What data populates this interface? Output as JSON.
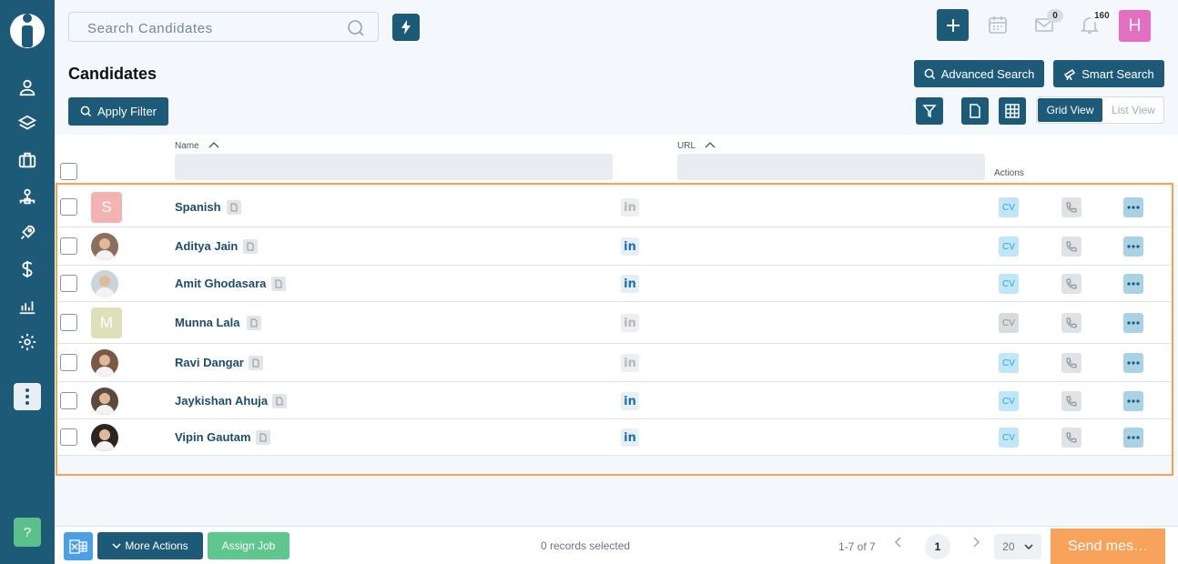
{
  "search": {
    "placeholder": "Search Candidates"
  },
  "header": {
    "mail_badge": "0",
    "notif_badge": "160",
    "user_initial": "H"
  },
  "page": {
    "title": "Candidates"
  },
  "buttons": {
    "advanced_search": "Advanced Search",
    "smart_search": "Smart Search",
    "apply_filter": "Apply Filter",
    "grid_view": "Grid View",
    "list_view": "List View"
  },
  "table": {
    "columns": {
      "name": "Name",
      "url": "URL",
      "actions": "Actions"
    },
    "rows": [
      {
        "name": "Spanish",
        "initial": "S",
        "avatar_color": "#f4b3b3",
        "linkedin": false,
        "cv_active": true
      },
      {
        "name": "Aditya Jain",
        "initial": "",
        "avatar_color": "#8a6f5c",
        "linkedin": true,
        "cv_active": true
      },
      {
        "name": "Amit Ghodasara",
        "initial": "",
        "avatar_color": "#c9d4dd",
        "linkedin": true,
        "cv_active": true
      },
      {
        "name": "Munna Lala",
        "initial": "M",
        "avatar_color": "#dde0b8",
        "linkedin": false,
        "cv_active": false
      },
      {
        "name": "Ravi Dangar",
        "initial": "",
        "avatar_color": "#7a5a46",
        "linkedin": false,
        "cv_active": true
      },
      {
        "name": "Jaykishan Ahuja",
        "initial": "",
        "avatar_color": "#5a4a40",
        "linkedin": true,
        "cv_active": true
      },
      {
        "name": "Vipin Gautam",
        "initial": "",
        "avatar_color": "#2c2420",
        "linkedin": true,
        "cv_active": true
      }
    ],
    "cv_label": "CV",
    "linkedin_label": "in"
  },
  "footer": {
    "more_actions": "More Actions",
    "assign_job": "Assign Job",
    "records_selected": "0 records selected",
    "page_info": "1-7 of 7",
    "current_page": "1",
    "per_page": "20",
    "send_message": "Send mes…"
  },
  "sidebar": {
    "help": "?"
  },
  "colors": {
    "primary": "#1d5a78",
    "accent_orange": "#f8a25c",
    "success": "#5fc68e",
    "linkedin": "#1d6fb8"
  }
}
